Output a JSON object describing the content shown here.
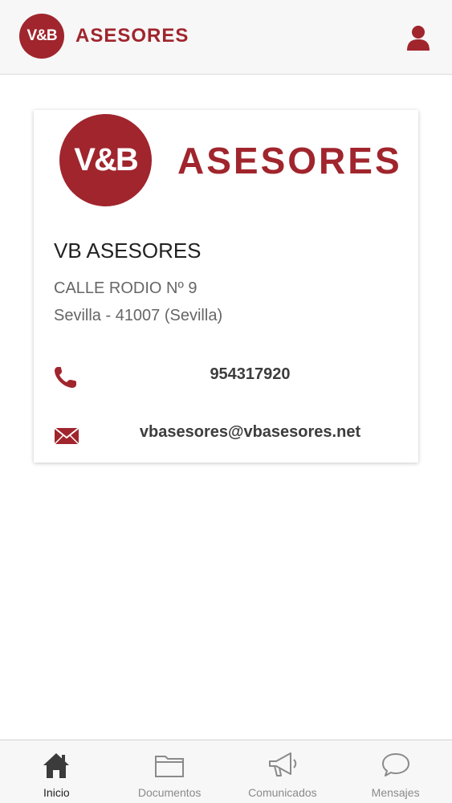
{
  "header": {
    "logo_text": "V&B",
    "brand": "ASESORES",
    "user_icon": "user-icon"
  },
  "card": {
    "logo_text": "V&B",
    "brand": "ASESORES",
    "company_name": "VB ASESORES",
    "address_line1": "CALLE RODIO Nº 9",
    "address_line2": "Sevilla - 41007 (Sevilla)",
    "phone": "954317920",
    "email": "vbasesores@vbasesores.net",
    "phone_icon": "phone-icon",
    "email_icon": "envelope-icon"
  },
  "tabs": [
    {
      "label": "Inicio",
      "icon": "home-icon",
      "active": true
    },
    {
      "label": "Documentos",
      "icon": "folder-icon",
      "active": false
    },
    {
      "label": "Comunicados",
      "icon": "megaphone-icon",
      "active": false
    },
    {
      "label": "Mensajes",
      "icon": "chat-bubble-icon",
      "active": false
    }
  ],
  "colors": {
    "brand": "#a0252d",
    "tab_active": "#222222",
    "tab_inactive": "#8a8a8a"
  }
}
